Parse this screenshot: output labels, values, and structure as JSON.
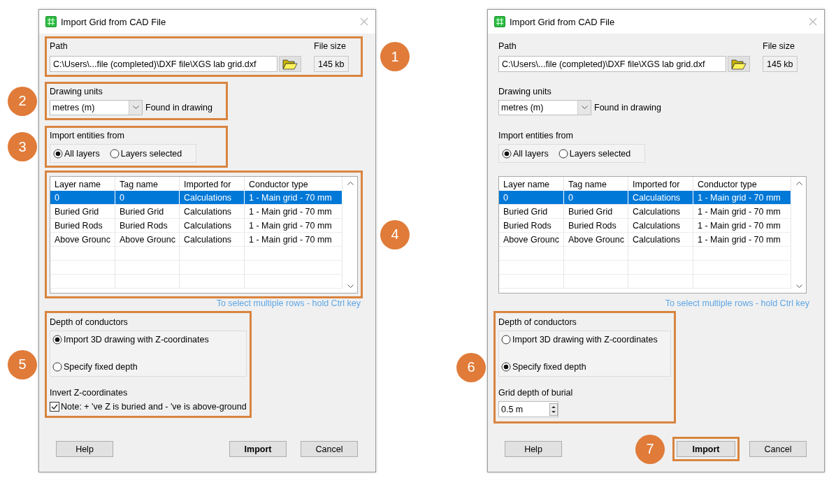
{
  "dialogs": [
    {
      "title": "Import Grid from CAD File",
      "path": {
        "label": "Path",
        "value": "C:\\Users\\...file (completed)\\DXF file\\XGS lab grid.dxf",
        "file_size_label": "File size",
        "file_size": "145 kb",
        "highlighted": true,
        "callout": "1"
      },
      "drawing_units": {
        "label": "Drawing units",
        "value": "metres (m)",
        "note": "Found in drawing",
        "highlighted": true,
        "callout": "2"
      },
      "import_entities": {
        "label": "Import entities from",
        "options": [
          {
            "label": "All layers",
            "selected": true
          },
          {
            "label": "Layers selected",
            "selected": false
          }
        ],
        "highlighted": true,
        "callout": "3"
      },
      "layers_table": {
        "columns": [
          "Layer name",
          "Tag name",
          "Imported for",
          "Conductor type"
        ],
        "rows": [
          {
            "cells": [
              "0",
              "0",
              "Calculations",
              "1 - Main grid - 70 mm"
            ],
            "selected": true
          },
          {
            "cells": [
              "Buried Grid",
              "Buried Grid",
              "Calculations",
              "1 - Main grid - 70 mm"
            ],
            "selected": false
          },
          {
            "cells": [
              "Buried Rods",
              "Buried Rods",
              "Calculations",
              "1 - Main grid - 70 mm"
            ],
            "selected": false
          },
          {
            "cells": [
              "Above Grounc",
              "Above Grounc",
              "Calculations",
              "1 - Main grid - 70 mm"
            ],
            "selected": false
          }
        ],
        "highlighted": true,
        "callout": "4"
      },
      "hint": "To select multiple rows - hold Ctrl key",
      "depth": {
        "label": "Depth of conductors",
        "options": [
          {
            "label": "Import 3D drawing with Z-coordinates",
            "selected": true
          },
          {
            "label": "Specify fixed depth",
            "selected": false
          }
        ],
        "extras": [
          {
            "kind": "label",
            "text": "Invert Z-coordinates"
          },
          {
            "kind": "checkbox",
            "label": "Note: + 've Z is buried and - 've is above-ground",
            "checked": true
          }
        ],
        "highlighted": true,
        "callout": "5"
      },
      "buttons": [
        {
          "label": "Help",
          "default": false,
          "highlighted": false
        },
        {
          "label": "Import",
          "default": true,
          "highlighted": false
        },
        {
          "label": "Cancel",
          "default": false,
          "highlighted": false
        }
      ]
    },
    {
      "title": "Import Grid from CAD File",
      "path": {
        "label": "Path",
        "value": "C:\\Users\\...file (completed)\\DXF file\\XGS lab grid.dxf",
        "file_size_label": "File size",
        "file_size": "145 kb",
        "highlighted": false
      },
      "drawing_units": {
        "label": "Drawing units",
        "value": "metres (m)",
        "note": "Found in drawing",
        "highlighted": false
      },
      "import_entities": {
        "label": "Import entities from",
        "options": [
          {
            "label": "All layers",
            "selected": true
          },
          {
            "label": "Layers selected",
            "selected": false
          }
        ],
        "highlighted": false
      },
      "layers_table": {
        "columns": [
          "Layer name",
          "Tag name",
          "Imported for",
          "Conductor type"
        ],
        "rows": [
          {
            "cells": [
              "0",
              "0",
              "Calculations",
              "1 - Main grid - 70 mm"
            ],
            "selected": true
          },
          {
            "cells": [
              "Buried Grid",
              "Buried Grid",
              "Calculations",
              "1 - Main grid - 70 mm"
            ],
            "selected": false
          },
          {
            "cells": [
              "Buried Rods",
              "Buried Rods",
              "Calculations",
              "1 - Main grid - 70 mm"
            ],
            "selected": false
          },
          {
            "cells": [
              "Above Grounc",
              "Above Grounc",
              "Calculations",
              "1 - Main grid - 70 mm"
            ],
            "selected": false
          }
        ],
        "highlighted": false
      },
      "hint": "To select multiple rows - hold Ctrl key",
      "depth": {
        "label": "Depth of conductors",
        "options": [
          {
            "label": "Import 3D drawing with Z-coordinates",
            "selected": false
          },
          {
            "label": "Specify fixed depth",
            "selected": true
          }
        ],
        "extras": [
          {
            "kind": "label",
            "text": "Grid depth of burial"
          },
          {
            "kind": "spinner",
            "value": "0.5 m"
          }
        ],
        "highlighted": true,
        "callout": "6"
      },
      "buttons": [
        {
          "label": "Help",
          "default": false,
          "highlighted": false
        },
        {
          "label": "Import",
          "default": true,
          "highlighted": true,
          "callout": "7"
        },
        {
          "label": "Cancel",
          "default": false,
          "highlighted": false
        }
      ]
    }
  ]
}
